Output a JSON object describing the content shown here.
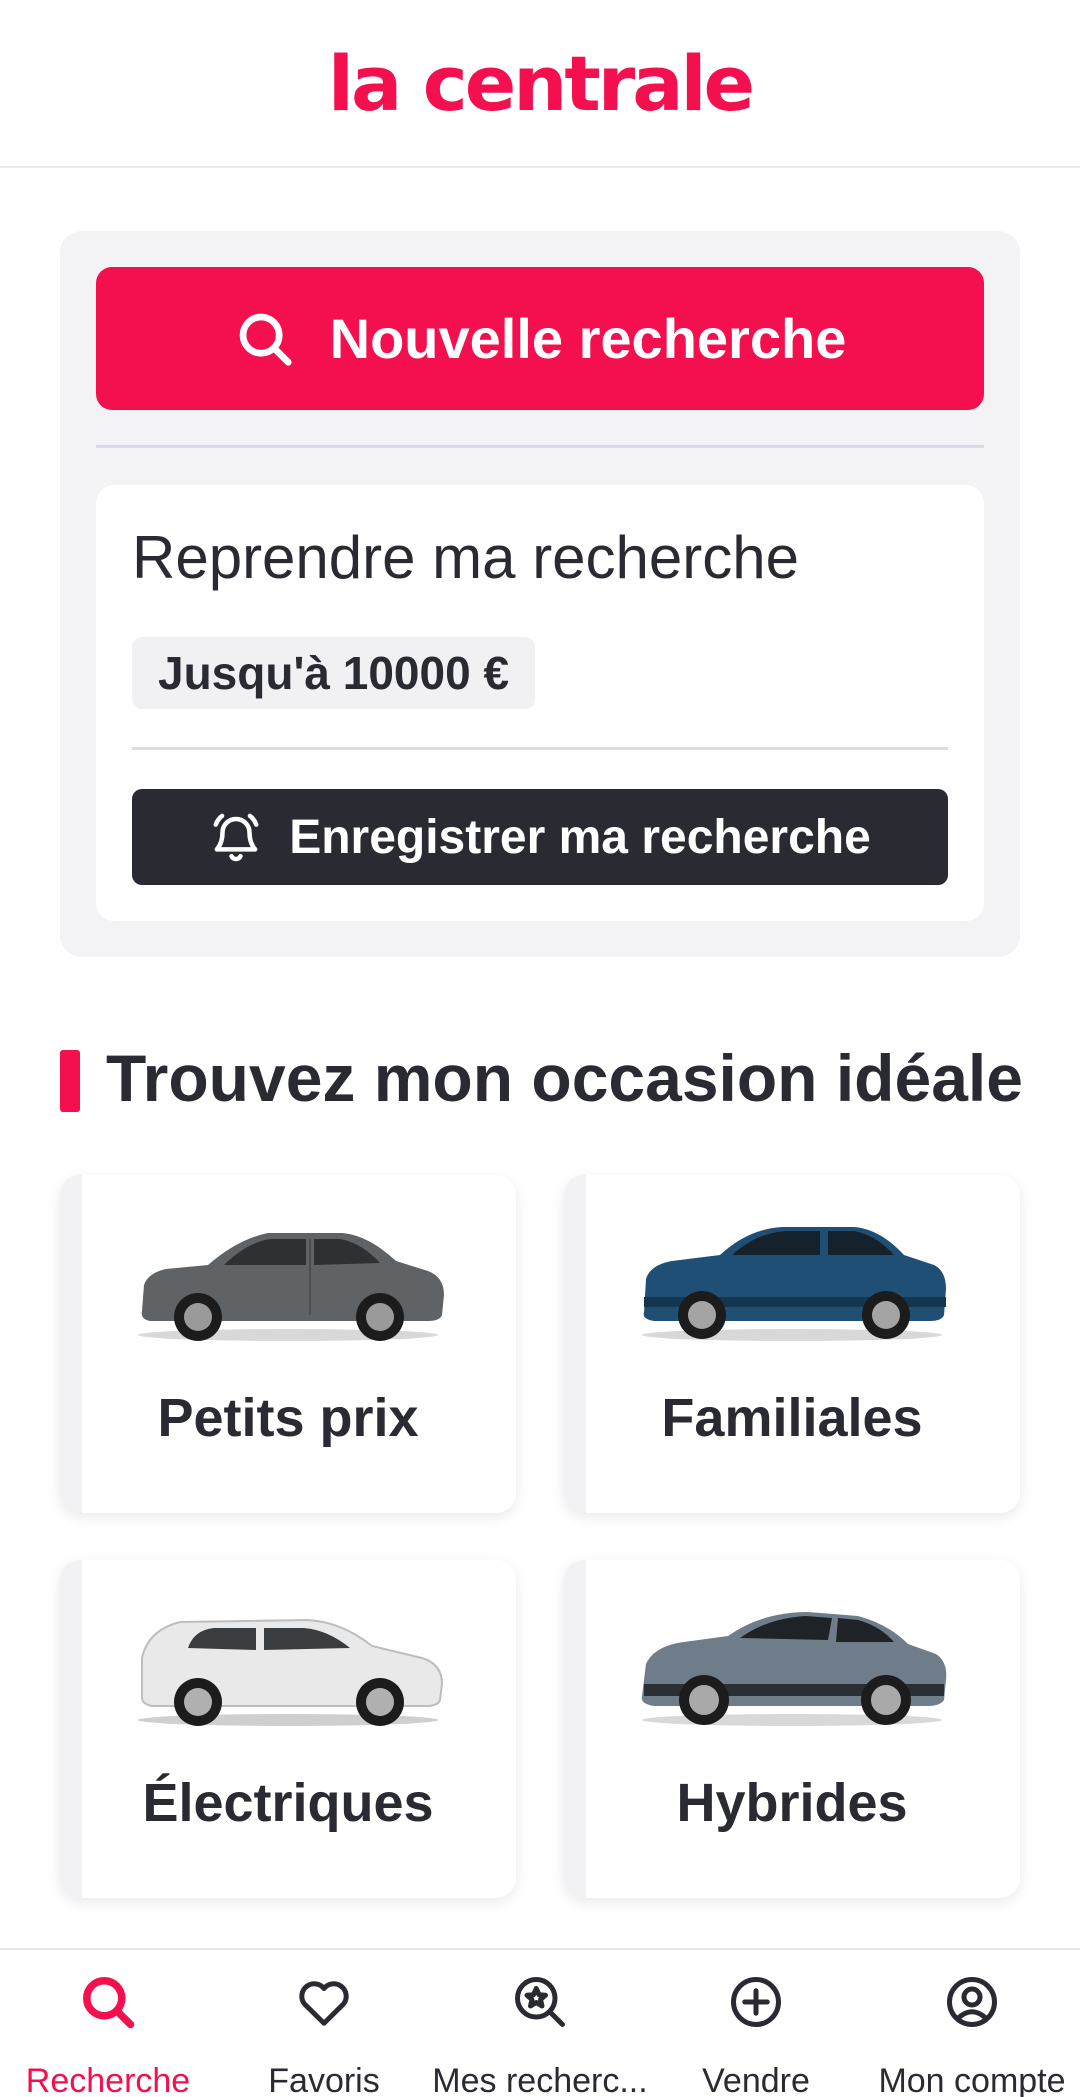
{
  "header": {
    "logo_text": "la centrale"
  },
  "search": {
    "new_search_label": "Nouvelle recherche",
    "resume": {
      "title": "Reprendre ma recherche",
      "criteria_chip": "Jusqu'à 10000 €",
      "save_label": "Enregistrer ma recherche"
    }
  },
  "section": {
    "title": "Trouvez mon occasion idéale"
  },
  "categories": [
    {
      "label": "Petits prix",
      "icon": "car-hatchback-grey"
    },
    {
      "label": "Familiales",
      "icon": "car-suv-blue"
    },
    {
      "label": "Électriques",
      "icon": "car-electric-white"
    },
    {
      "label": "Hybrides",
      "icon": "car-crossover-grey"
    }
  ],
  "nav": [
    {
      "label": "Recherche",
      "icon": "search-icon",
      "active": true
    },
    {
      "label": "Favoris",
      "icon": "heart-icon",
      "active": false
    },
    {
      "label": "Mes recherc...",
      "icon": "saved-search-icon",
      "active": false
    },
    {
      "label": "Vendre",
      "icon": "plus-circle-icon",
      "active": false
    },
    {
      "label": "Mon compte",
      "icon": "account-icon",
      "active": false
    }
  ],
  "colors": {
    "brand": "#f4104f",
    "dark": "#2a2a33",
    "card_bg": "#f3f3f6"
  }
}
